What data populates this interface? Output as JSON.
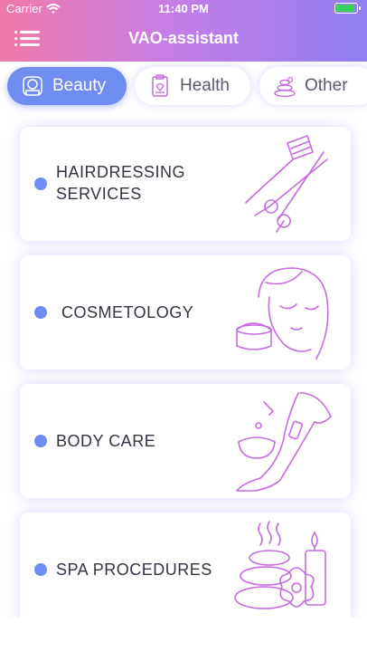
{
  "status": {
    "carrier": "Carrier",
    "time": "11:40 PM"
  },
  "app": {
    "title": "VAO-assistant"
  },
  "tabs": [
    {
      "label": "Beauty",
      "active": true,
      "icon": "beauty-station-icon"
    },
    {
      "label": "Health",
      "active": false,
      "icon": "health-clipboard-icon"
    },
    {
      "label": "Other",
      "active": false,
      "icon": "other-stones-icon"
    }
  ],
  "services": [
    {
      "label": "HAIRDRESSING SERVICES",
      "icon": "hair-dye-brush-scissors-icon"
    },
    {
      "label": "COSMETOLOGY",
      "icon": "face-cream-icon"
    },
    {
      "label": "BODY CARE",
      "icon": "legs-wax-icon"
    },
    {
      "label": "SPA PROCEDURES",
      "icon": "spa-stones-candle-icon"
    }
  ],
  "colors": {
    "accent": "#6f8df0",
    "gradient_start": "#f07aa8",
    "gradient_end": "#8f7ff0",
    "icon_stroke": "#c66be0"
  }
}
